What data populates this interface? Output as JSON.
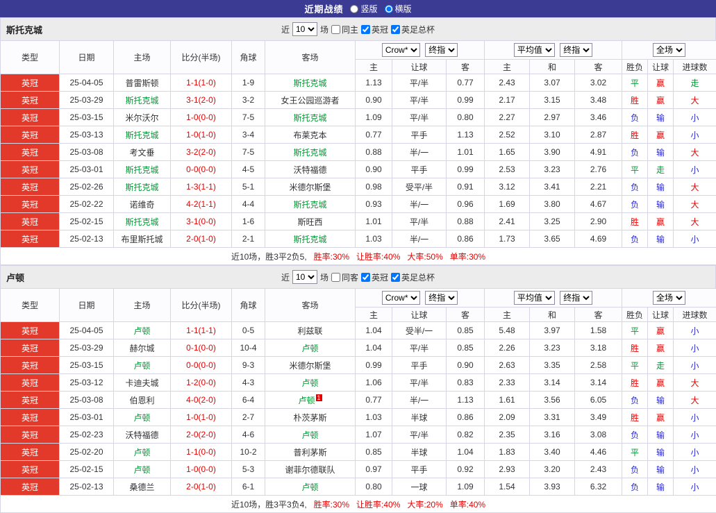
{
  "topbar": {
    "title": "近期战绩",
    "layout_options": [
      {
        "label": "竖版",
        "selected": false
      },
      {
        "label": "横版",
        "selected": true
      }
    ]
  },
  "columns": {
    "type": "类型",
    "date": "日期",
    "home": "主场",
    "score": "比分(半场)",
    "corner": "角球",
    "away": "客场",
    "odds_sub": [
      "主",
      "让球",
      "客"
    ],
    "avg_sub": [
      "主",
      "和",
      "客"
    ],
    "result_sub": [
      "胜负",
      "让球",
      "进球数"
    ]
  },
  "colors": {
    "topbar_navy": "#3b3b94",
    "badge_red": "#e3392b",
    "win_red": "#e60000",
    "draw_green": "#009933",
    "loss_blue": "#2929d6"
  },
  "sections": [
    {
      "team": "斯托克城",
      "filter": {
        "near_label": "近",
        "count": "10",
        "games_label": "场",
        "same_side_label": "同主",
        "same_side_checked": false,
        "leagues": [
          {
            "label": "英冠",
            "checked": true
          },
          {
            "label": "英足总杯",
            "checked": true
          }
        ]
      },
      "selects": {
        "company": "Crow*",
        "company_stage": "终指",
        "avg": "平均值",
        "avg_stage": "终指",
        "scope": "全场"
      },
      "rows": [
        {
          "type": "英冠",
          "date": "25-04-05",
          "home": "普雷斯顿",
          "home_featured": false,
          "score": "1-1(1-0)",
          "corner": "1-9",
          "away": "斯托克城",
          "away_featured": true,
          "h_odds": "1.13",
          "handicap": "平/半",
          "a_odds": "0.77",
          "avg_h": "2.43",
          "avg_d": "3.07",
          "avg_a": "3.02",
          "result": "平",
          "asian": "赢",
          "goals": "走"
        },
        {
          "type": "英冠",
          "date": "25-03-29",
          "home": "斯托克城",
          "home_featured": true,
          "score": "3-1(2-0)",
          "corner": "3-2",
          "away": "女王公园巡游者",
          "away_featured": false,
          "h_odds": "0.90",
          "handicap": "平/半",
          "a_odds": "0.99",
          "avg_h": "2.17",
          "avg_d": "3.15",
          "avg_a": "3.48",
          "result": "胜",
          "asian": "赢",
          "goals": "大"
        },
        {
          "type": "英冠",
          "date": "25-03-15",
          "home": "米尔沃尔",
          "home_featured": false,
          "score": "1-0(0-0)",
          "corner": "7-5",
          "away": "斯托克城",
          "away_featured": true,
          "h_odds": "1.09",
          "handicap": "平/半",
          "a_odds": "0.80",
          "avg_h": "2.27",
          "avg_d": "2.97",
          "avg_a": "3.46",
          "result": "负",
          "asian": "输",
          "goals": "小"
        },
        {
          "type": "英冠",
          "date": "25-03-13",
          "home": "斯托克城",
          "home_featured": true,
          "score": "1-0(1-0)",
          "corner": "3-4",
          "away": "布莱克本",
          "away_featured": false,
          "h_odds": "0.77",
          "handicap": "平手",
          "a_odds": "1.13",
          "avg_h": "2.52",
          "avg_d": "3.10",
          "avg_a": "2.87",
          "result": "胜",
          "asian": "赢",
          "goals": "小"
        },
        {
          "type": "英冠",
          "date": "25-03-08",
          "home": "考文垂",
          "home_featured": false,
          "score": "3-2(2-0)",
          "corner": "7-5",
          "away": "斯托克城",
          "away_featured": true,
          "h_odds": "0.88",
          "handicap": "半/一",
          "a_odds": "1.01",
          "avg_h": "1.65",
          "avg_d": "3.90",
          "avg_a": "4.91",
          "result": "负",
          "asian": "输",
          "goals": "大"
        },
        {
          "type": "英冠",
          "date": "25-03-01",
          "home": "斯托克城",
          "home_featured": true,
          "score": "0-0(0-0)",
          "corner": "4-5",
          "away": "沃特福德",
          "away_featured": false,
          "h_odds": "0.90",
          "handicap": "平手",
          "a_odds": "0.99",
          "avg_h": "2.53",
          "avg_d": "3.23",
          "avg_a": "2.76",
          "result": "平",
          "asian": "走",
          "goals": "小"
        },
        {
          "type": "英冠",
          "date": "25-02-26",
          "home": "斯托克城",
          "home_featured": true,
          "score": "1-3(1-1)",
          "corner": "5-1",
          "away": "米德尔斯堡",
          "away_featured": false,
          "h_odds": "0.98",
          "handicap": "受平/半",
          "a_odds": "0.91",
          "avg_h": "3.12",
          "avg_d": "3.41",
          "avg_a": "2.21",
          "result": "负",
          "asian": "输",
          "goals": "大"
        },
        {
          "type": "英冠",
          "date": "25-02-22",
          "home": "诺维奇",
          "home_featured": false,
          "score": "4-2(1-1)",
          "corner": "4-4",
          "away": "斯托克城",
          "away_featured": true,
          "h_odds": "0.93",
          "handicap": "半/一",
          "a_odds": "0.96",
          "avg_h": "1.69",
          "avg_d": "3.80",
          "avg_a": "4.67",
          "result": "负",
          "asian": "输",
          "goals": "大"
        },
        {
          "type": "英冠",
          "date": "25-02-15",
          "home": "斯托克城",
          "home_featured": true,
          "score": "3-1(0-0)",
          "corner": "1-6",
          "away": "斯旺西",
          "away_featured": false,
          "h_odds": "1.01",
          "handicap": "平/半",
          "a_odds": "0.88",
          "avg_h": "2.41",
          "avg_d": "3.25",
          "avg_a": "2.90",
          "result": "胜",
          "asian": "赢",
          "goals": "大"
        },
        {
          "type": "英冠",
          "date": "25-02-13",
          "home": "布里斯托城",
          "home_featured": false,
          "score": "2-0(1-0)",
          "corner": "2-1",
          "away": "斯托克城",
          "away_featured": true,
          "h_odds": "1.03",
          "handicap": "半/一",
          "a_odds": "0.86",
          "avg_h": "1.73",
          "avg_d": "3.65",
          "avg_a": "4.69",
          "result": "负",
          "asian": "输",
          "goals": "小"
        }
      ],
      "summary": {
        "prefix": "近10场，胜3平2负5,",
        "stats": [
          "胜率:30%",
          "让胜率:40%",
          "大率:50%",
          "单率:30%"
        ]
      }
    },
    {
      "team": "卢顿",
      "filter": {
        "near_label": "近",
        "count": "10",
        "games_label": "场",
        "same_side_label": "同客",
        "same_side_checked": false,
        "leagues": [
          {
            "label": "英冠",
            "checked": true
          },
          {
            "label": "英足总杯",
            "checked": true
          }
        ]
      },
      "selects": {
        "company": "Crow*",
        "company_stage": "终指",
        "avg": "平均值",
        "avg_stage": "终指",
        "scope": "全场"
      },
      "rows": [
        {
          "type": "英冠",
          "date": "25-04-05",
          "home": "卢顿",
          "home_featured": true,
          "score": "1-1(1-1)",
          "corner": "0-5",
          "away": "利兹联",
          "away_featured": false,
          "h_odds": "1.04",
          "handicap": "受半/一",
          "a_odds": "0.85",
          "avg_h": "5.48",
          "avg_d": "3.97",
          "avg_a": "1.58",
          "result": "平",
          "asian": "赢",
          "goals": "小"
        },
        {
          "type": "英冠",
          "date": "25-03-29",
          "home": "赫尔城",
          "home_featured": false,
          "score": "0-1(0-0)",
          "corner": "10-4",
          "away": "卢顿",
          "away_featured": true,
          "h_odds": "1.04",
          "handicap": "平/半",
          "a_odds": "0.85",
          "avg_h": "2.26",
          "avg_d": "3.23",
          "avg_a": "3.18",
          "result": "胜",
          "asian": "赢",
          "goals": "小"
        },
        {
          "type": "英冠",
          "date": "25-03-15",
          "home": "卢顿",
          "home_featured": true,
          "score": "0-0(0-0)",
          "corner": "9-3",
          "away": "米德尔斯堡",
          "away_featured": false,
          "h_odds": "0.99",
          "handicap": "平手",
          "a_odds": "0.90",
          "avg_h": "2.63",
          "avg_d": "3.35",
          "avg_a": "2.58",
          "result": "平",
          "asian": "走",
          "goals": "小"
        },
        {
          "type": "英冠",
          "date": "25-03-12",
          "home": "卡迪夫城",
          "home_featured": false,
          "score": "1-2(0-0)",
          "corner": "4-3",
          "away": "卢顿",
          "away_featured": true,
          "h_odds": "1.06",
          "handicap": "平/半",
          "a_odds": "0.83",
          "avg_h": "2.33",
          "avg_d": "3.14",
          "avg_a": "3.14",
          "result": "胜",
          "asian": "赢",
          "goals": "大"
        },
        {
          "type": "英冠",
          "date": "25-03-08",
          "home": "伯恩利",
          "home_featured": false,
          "score": "4-0(2-0)",
          "corner": "6-4",
          "away": "卢顿",
          "away_featured": true,
          "away_note": "1",
          "h_odds": "0.77",
          "handicap": "半/一",
          "a_odds": "1.13",
          "avg_h": "1.61",
          "avg_d": "3.56",
          "avg_a": "6.05",
          "result": "负",
          "asian": "输",
          "goals": "大"
        },
        {
          "type": "英冠",
          "date": "25-03-01",
          "home": "卢顿",
          "home_featured": true,
          "score": "1-0(1-0)",
          "corner": "2-7",
          "away": "朴茨茅斯",
          "away_featured": false,
          "h_odds": "1.03",
          "handicap": "半球",
          "a_odds": "0.86",
          "avg_h": "2.09",
          "avg_d": "3.31",
          "avg_a": "3.49",
          "result": "胜",
          "asian": "赢",
          "goals": "小"
        },
        {
          "type": "英冠",
          "date": "25-02-23",
          "home": "沃特福德",
          "home_featured": false,
          "score": "2-0(2-0)",
          "corner": "4-6",
          "away": "卢顿",
          "away_featured": true,
          "h_odds": "1.07",
          "handicap": "平/半",
          "a_odds": "0.82",
          "avg_h": "2.35",
          "avg_d": "3.16",
          "avg_a": "3.08",
          "result": "负",
          "asian": "输",
          "goals": "小"
        },
        {
          "type": "英冠",
          "date": "25-02-20",
          "home": "卢顿",
          "home_featured": true,
          "score": "1-1(0-0)",
          "corner": "10-2",
          "away": "普利茅斯",
          "away_featured": false,
          "h_odds": "0.85",
          "handicap": "半球",
          "a_odds": "1.04",
          "avg_h": "1.83",
          "avg_d": "3.40",
          "avg_a": "4.46",
          "result": "平",
          "asian": "输",
          "goals": "小"
        },
        {
          "type": "英冠",
          "date": "25-02-15",
          "home": "卢顿",
          "home_featured": true,
          "score": "1-0(0-0)",
          "corner": "5-3",
          "away": "谢菲尔德联队",
          "away_featured": false,
          "h_odds": "0.97",
          "handicap": "平手",
          "a_odds": "0.92",
          "avg_h": "2.93",
          "avg_d": "3.20",
          "avg_a": "2.43",
          "result": "负",
          "asian": "输",
          "goals": "小"
        },
        {
          "type": "英冠",
          "date": "25-02-13",
          "home": "桑德兰",
          "home_featured": false,
          "score": "2-0(1-0)",
          "corner": "6-1",
          "away": "卢顿",
          "away_featured": true,
          "h_odds": "0.80",
          "handicap": "一球",
          "a_odds": "1.09",
          "avg_h": "1.54",
          "avg_d": "3.93",
          "avg_a": "6.32",
          "result": "负",
          "asian": "输",
          "goals": "小"
        }
      ],
      "summary": {
        "prefix": "近10场，胜3平3负4,",
        "stats": [
          "胜率:30%",
          "让胜率:40%",
          "大率:20%",
          "单率:40%"
        ]
      }
    }
  ]
}
